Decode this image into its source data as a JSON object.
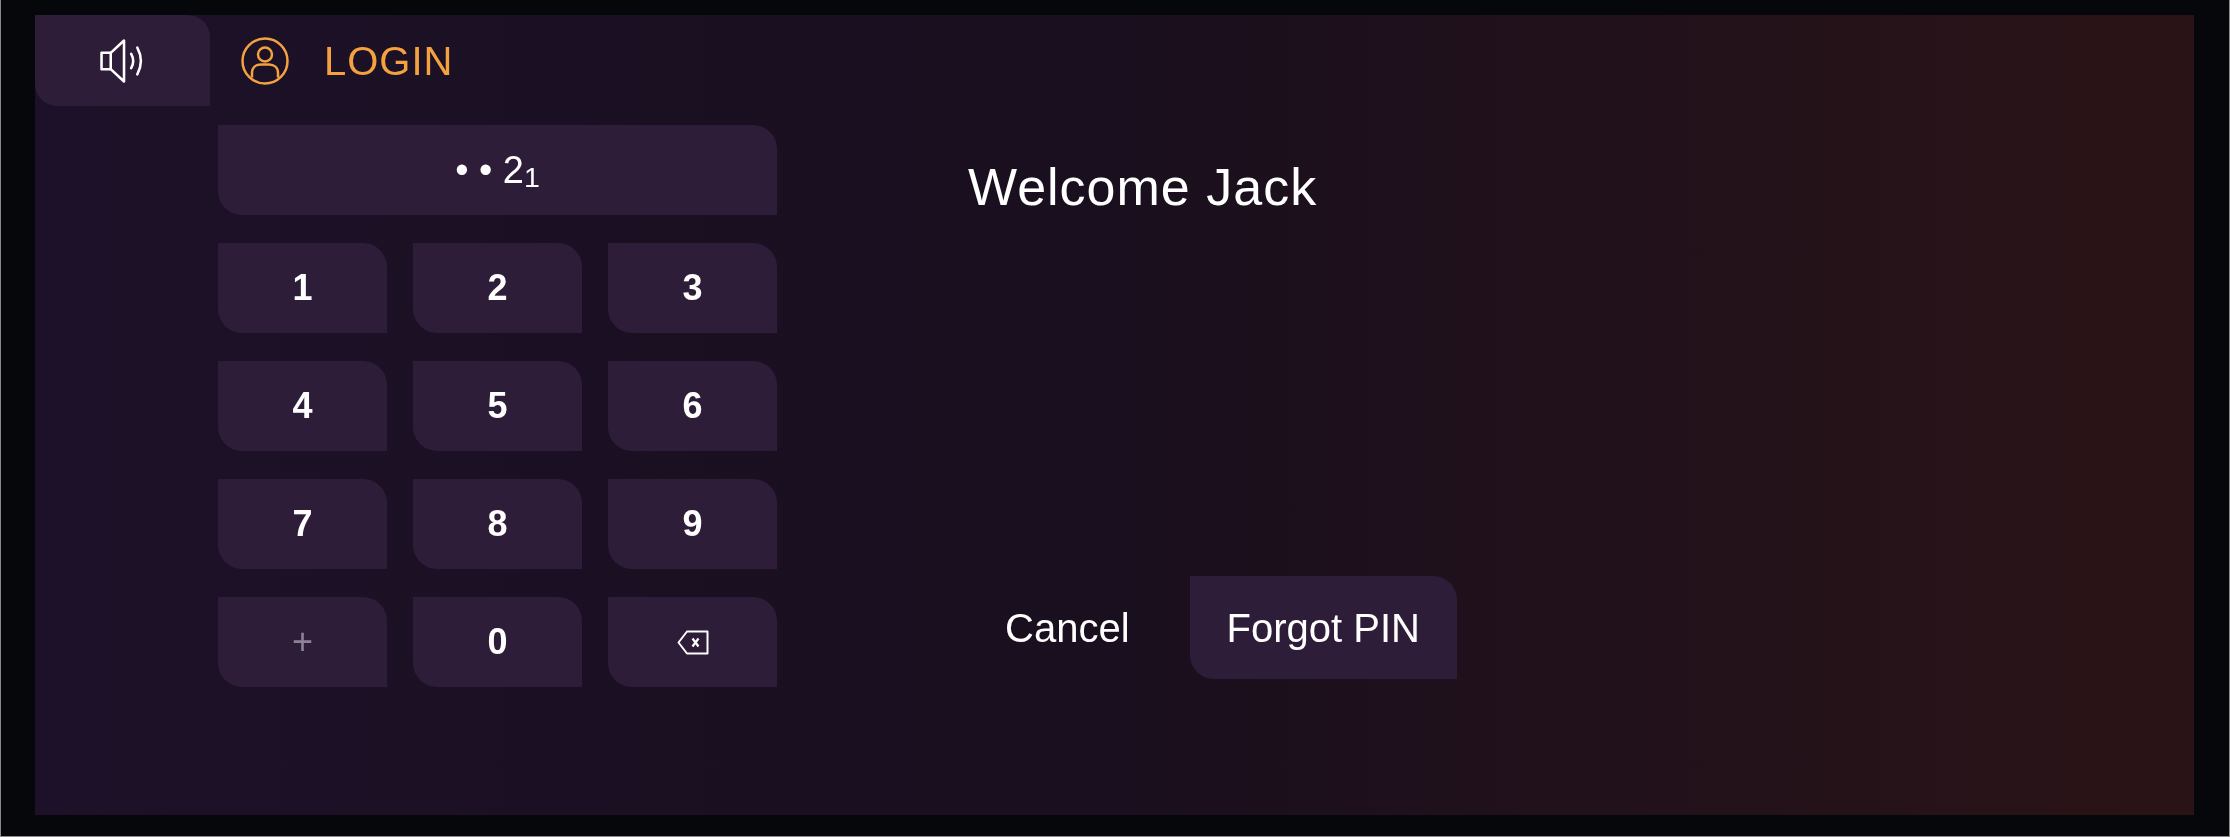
{
  "header": {
    "title": "LOGIN"
  },
  "pin_field": {
    "value": "• • 2$_{1}$"
  },
  "keypad": {
    "keys": [
      {
        "kind": "text",
        "label": "1",
        "disabled": false
      },
      {
        "kind": "text",
        "label": "2",
        "disabled": false
      },
      {
        "kind": "text",
        "label": "3",
        "disabled": false
      },
      {
        "kind": "text",
        "label": "4",
        "disabled": false
      },
      {
        "kind": "text",
        "label": "5",
        "disabled": false
      },
      {
        "kind": "text",
        "label": "6",
        "disabled": false
      },
      {
        "kind": "text",
        "label": "7",
        "disabled": false
      },
      {
        "kind": "text",
        "label": "8",
        "disabled": false
      },
      {
        "kind": "text",
        "label": "9",
        "disabled": false
      },
      {
        "kind": "text",
        "label": "+",
        "disabled": true
      },
      {
        "kind": "text",
        "label": "0",
        "disabled": false
      },
      {
        "kind": "backspace",
        "disabled": false
      }
    ]
  },
  "greeting": "Welcome Jack",
  "actions": [
    {
      "label": "Cancel",
      "kind": "text"
    },
    {
      "label": "Forgot PIN",
      "kind": "filled"
    }
  ]
}
